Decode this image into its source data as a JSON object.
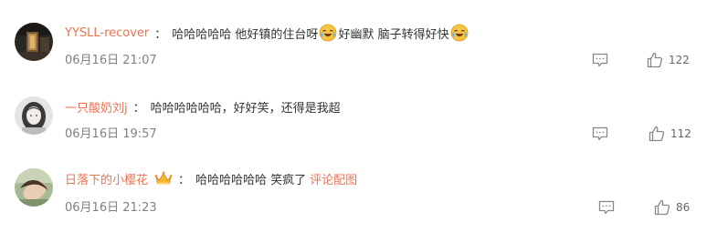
{
  "comments": [
    {
      "username": "YYSLL-recover",
      "separator": "：",
      "text_1": "哈哈哈哈哈 他好镇的住台呀",
      "emoji_1": "laughing-crying-emoji",
      "text_2": "好幽默 脑子转得好快",
      "emoji_2": "laughing-crying-emoji",
      "timestamp": "06月16日 21:07",
      "likes": "122"
    },
    {
      "username": "一只酸奶刘j",
      "separator": "：",
      "text": "哈哈哈哈哈哈，好好笑，还得是我超",
      "timestamp": "06月16日 19:57",
      "likes": "112"
    },
    {
      "username": "日落下的小樱花",
      "badge_icon": "crown-icon",
      "separator": "：",
      "text": "哈哈哈哈哈哈 笑疯了",
      "link": "评论配图",
      "timestamp": "06月16日 21:23",
      "likes": "86"
    }
  ],
  "colors": {
    "username": "#eb7350",
    "text": "#333333",
    "meta": "#808080",
    "icon": "#888888"
  },
  "icons": {
    "reply": "comment-icon",
    "like": "thumbs-up-icon"
  }
}
